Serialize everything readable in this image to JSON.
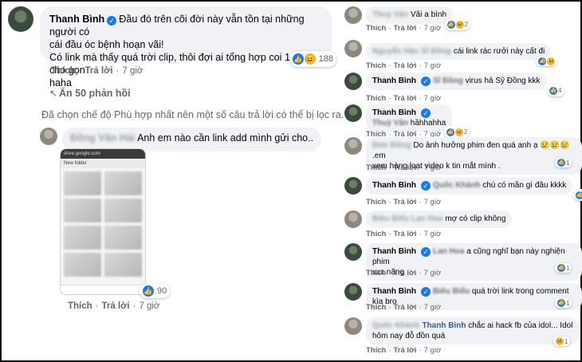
{
  "main_comment": {
    "author": "Thanh Bình",
    "text_line1": "Đầu đó trên cõi đời này vẫn tồn tại những người có",
    "text_line2": "cái đầu óc bệnh hoạn vãi!",
    "text_line3": "Có link mà thấy quá trời clip, thôi đợi ai tổng hợp coi 1 lần cho gọn",
    "text_line4": "haha",
    "reaction_count": "188",
    "like_label": "Thích",
    "reply_label": "Trả lời",
    "time": "7 giờ"
  },
  "hide_replies_label": "Ẩn 50 phản hồi",
  "filter_note": "Đã chọn chế độ Phù hợp nhất nên một số câu trả lời có thể bị lọc ra.",
  "reply": {
    "author": "Đồng Văn Hải",
    "text": "Anh em nào cần link add mình gửi cho..",
    "phone_topbar": "drive.google.com",
    "phone_folder": "New folder",
    "reaction_count": "90",
    "like_label": "Thích",
    "reply_label": "Trả lời",
    "time": "7 giờ"
  },
  "side_comments": [
    {
      "author": "Thuỳ Vân",
      "text": "Vãi a bình",
      "count": "2",
      "like": "Thích",
      "reply": "Trả lời",
      "time": "7 giờ"
    },
    {
      "author": "Nguyễn Hậu Sĩ Đồng",
      "text": "cái link rác rưởi này cất đi",
      "count": "",
      "like": "Thích",
      "reply": "Trả lời",
      "time": "7 giờ"
    },
    {
      "author": "Thanh Bình",
      "tag": "Sĩ Đồng",
      "text": "virus hả Sỹ Đồng kkk",
      "count": "4",
      "like": "Thích",
      "reply": "Trả lời",
      "time": "7 giờ"
    },
    {
      "author": "Thanh Bình",
      "tag": "Thuỳ Vân",
      "text": "hầhhahha",
      "count": "2",
      "like": "Thích",
      "reply": "Trả lời",
      "time": "7 giờ"
    },
    {
      "author": "Đức Đông",
      "text1": "Do ảnh hưởng phim đen quá anh ạ 😢😢😢 .em",
      "text2": "xem hàng loạt video k tin mắt mình .",
      "count": "1",
      "like": "Thích",
      "reply": "Trả lời",
      "time": "7 giờ"
    },
    {
      "author": "Thanh Bình",
      "tag": "Quốc Khánh",
      "text": "chú có mần gì đâu kkkk",
      "count": "1",
      "like": "Thích",
      "reply": "Trả lời",
      "time": "7 giờ"
    },
    {
      "author": "Biêu Biểu Lan Hoa",
      "text": "mợ có clip không",
      "count": "",
      "like": "Thích",
      "reply": "Trả lời",
      "time": "7 giờ"
    },
    {
      "author": "Thanh Bình",
      "tag": "Lan Hoa",
      "text1": "a cũng nghĩ bạn này nghiện phim",
      "text2": "xxx nặng",
      "count": "1",
      "like": "Thích",
      "reply": "Trả lời",
      "time": "7 giờ"
    },
    {
      "author": "Thanh Bình",
      "tag": "Biêu Biểu",
      "text": "quá trời link trong comment kìa bro",
      "count": "1",
      "like": "Thích",
      "reply": "Trả lời",
      "time": "7 giờ"
    },
    {
      "author": "Quốc Khánh",
      "tag": "Thanh Bình",
      "text1": "chắc ai hack fb của idol... Idol",
      "text2": "hôm nay đỗ đồn quá",
      "count": "1",
      "like": "Thích",
      "reply": "Trả lời",
      "time": "7 giờ"
    }
  ],
  "colors": {
    "like_blue": "#1877f2",
    "bubble": "#f0f2f5",
    "meta_gray": "#65676b"
  },
  "icons": [
    "verified-icon",
    "like-reaction-icon",
    "haha-reaction-icon",
    "sad-reaction-icon",
    "reply-arrow-icon"
  ]
}
